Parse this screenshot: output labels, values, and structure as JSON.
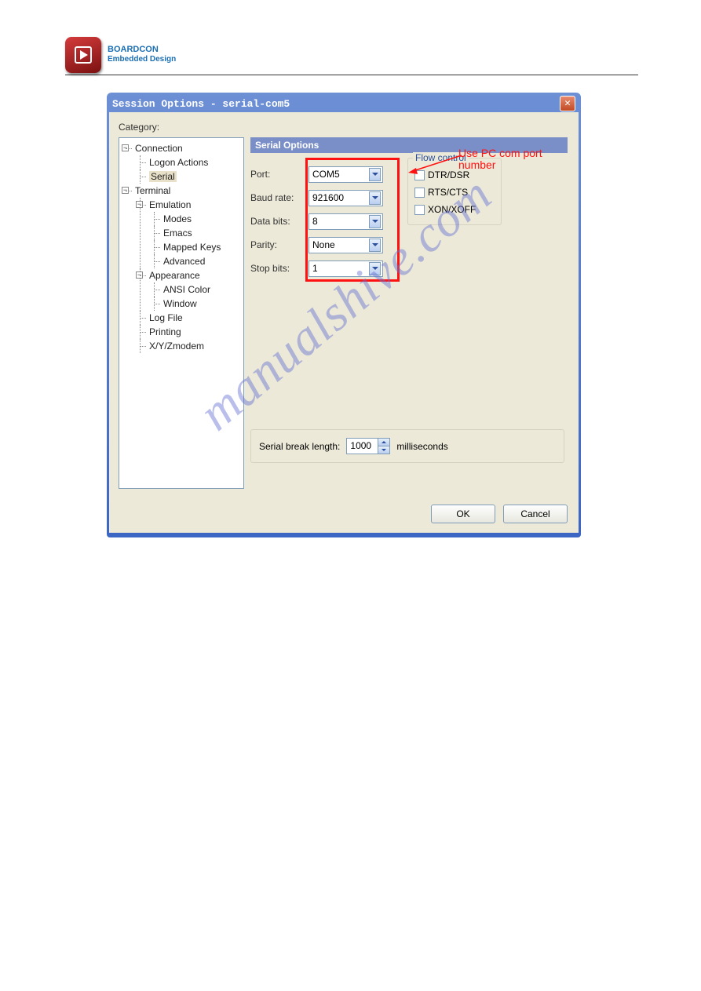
{
  "brand": {
    "line1": "BOARDCON",
    "line2": "Embedded Design"
  },
  "dialog": {
    "title": "Session Options - serial-com5",
    "category_label": "Category:",
    "section_header": "Serial Options",
    "tree": {
      "connection": "Connection",
      "logon_actions": "Logon Actions",
      "serial": "Serial",
      "terminal": "Terminal",
      "emulation": "Emulation",
      "modes": "Modes",
      "emacs": "Emacs",
      "mapped_keys": "Mapped Keys",
      "advanced": "Advanced",
      "appearance": "Appearance",
      "ansi_color": "ANSI Color",
      "window": "Window",
      "log_file": "Log File",
      "printing": "Printing",
      "xyz": "X/Y/Zmodem"
    },
    "labels": {
      "port": "Port:",
      "baud": "Baud rate:",
      "data_bits": "Data bits:",
      "parity": "Parity:",
      "stop_bits": "Stop bits:",
      "flow_control": "Flow control",
      "dtr": "DTR/DSR",
      "rts": "RTS/CTS",
      "xon": "XON/XOFF",
      "break_len": "Serial break length:",
      "ms": "milliseconds"
    },
    "values": {
      "port": "COM5",
      "baud": "921600",
      "data_bits": "8",
      "parity": "None",
      "stop_bits": "1",
      "break_len": "1000"
    },
    "buttons": {
      "ok": "OK",
      "cancel": "Cancel"
    }
  },
  "annotation": {
    "line1": "Use PC com port",
    "line2": "number"
  },
  "watermark": "manualshive.com"
}
